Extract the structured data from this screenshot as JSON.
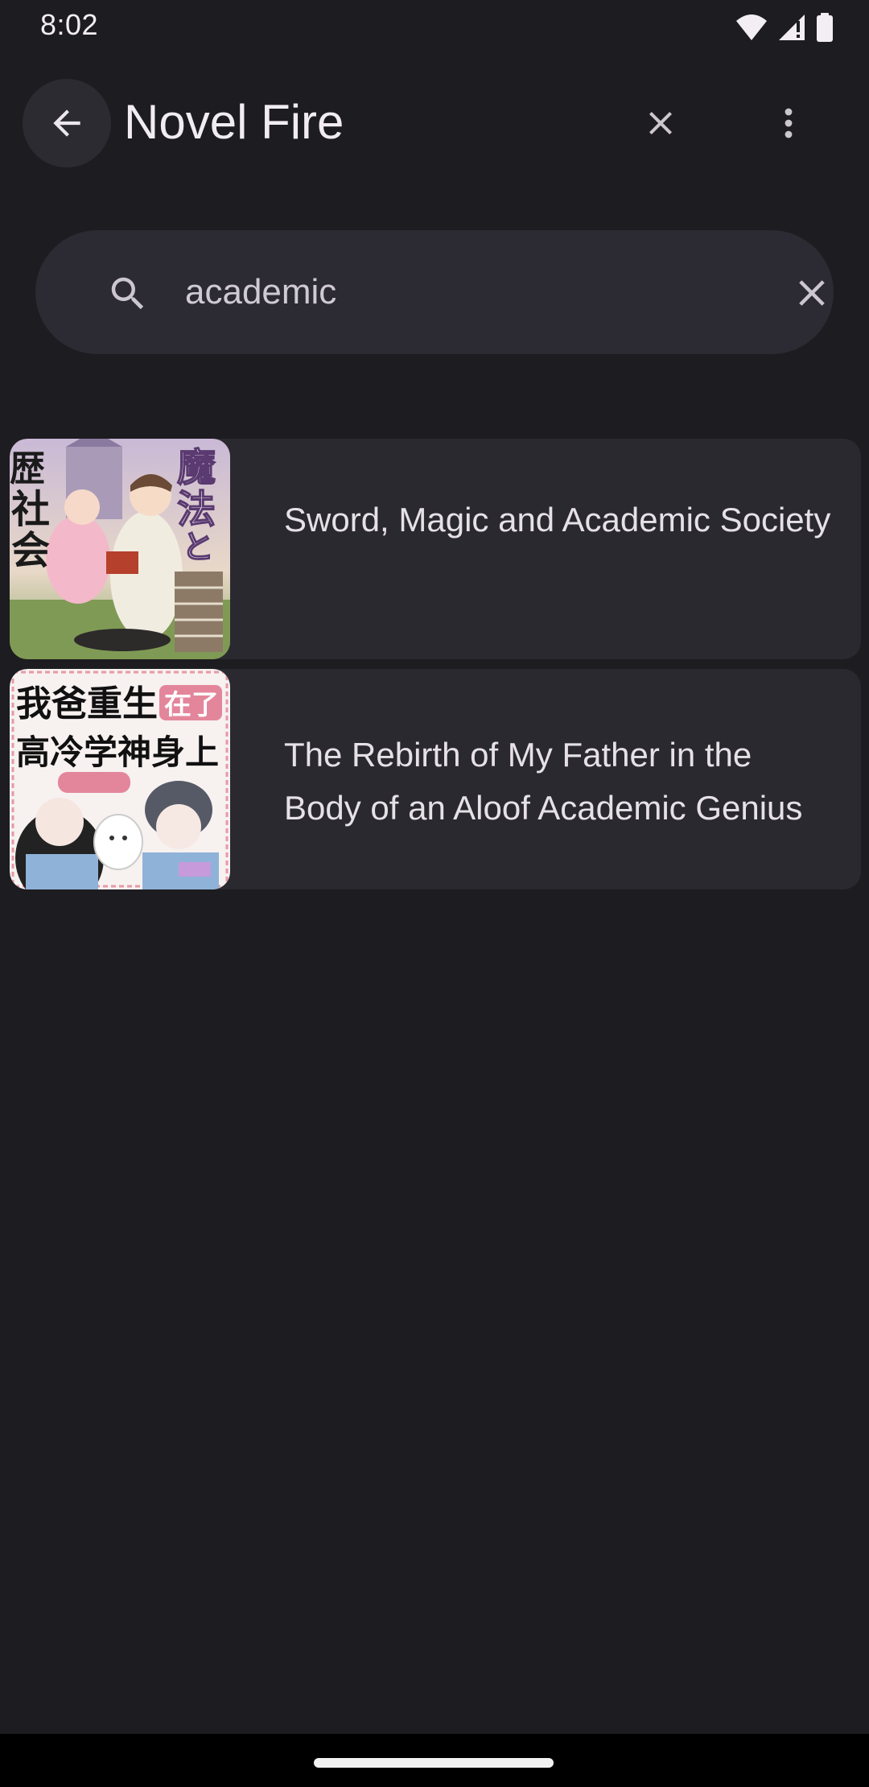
{
  "status_bar": {
    "time": "8:02"
  },
  "app_bar": {
    "title": "Novel Fire",
    "back_icon": "arrow-left-icon",
    "close_icon": "close-icon",
    "more_icon": "more-vert-icon"
  },
  "search": {
    "value": "academic",
    "icon": "search-icon",
    "clear_icon": "clear-icon"
  },
  "results": [
    {
      "title": "Sword, Magic and Academic Society",
      "cover_text": [
        "魔",
        "法",
        "と",
        "社",
        "会"
      ]
    },
    {
      "title": "The Rebirth of My Father in the Body of an Aloof Academic Genius",
      "cover_text": [
        "我爸重生",
        "在了",
        "高冷学神身上"
      ]
    }
  ],
  "colors": {
    "background": "#1d1c20",
    "surface": "#2b2930",
    "search_surface": "#2c2b33",
    "text": "#e6e1e7"
  }
}
